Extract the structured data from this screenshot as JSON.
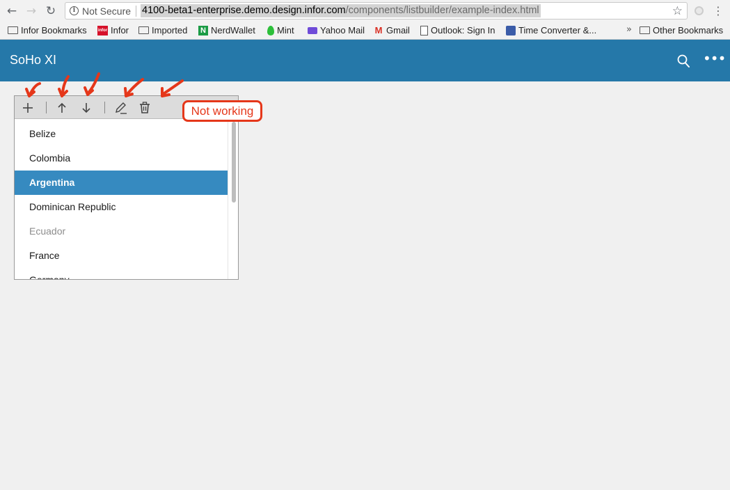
{
  "browser": {
    "back": "←",
    "forward": "→",
    "reload": "↻",
    "security_label": "Not Secure",
    "url_host": "4100-beta1-enterprise.demo.design.infor.com",
    "url_path": "/components/listbuilder/example-index.html",
    "bookmark_star": "☆",
    "menu": "⋮",
    "bookmarks": [
      {
        "label": "Infor Bookmarks",
        "icon": "folder-icon"
      },
      {
        "label": "Infor",
        "icon": "infor-logo-icon",
        "icon_text": "infor"
      },
      {
        "label": "Imported",
        "icon": "folder-icon"
      },
      {
        "label": "NerdWallet",
        "icon": "nerdwallet-icon",
        "icon_text": "N"
      },
      {
        "label": "Mint",
        "icon": "mint-icon"
      },
      {
        "label": "Yahoo Mail",
        "icon": "mail-icon"
      },
      {
        "label": "Gmail",
        "icon": "gmail-icon",
        "icon_text": "M"
      },
      {
        "label": "Outlook: Sign In",
        "icon": "document-icon"
      },
      {
        "label": "Time Converter &...",
        "icon": "clock-icon"
      }
    ],
    "bookmarks_more": "»",
    "other_bookmarks": "Other Bookmarks"
  },
  "app": {
    "title": "SoHo XI",
    "more_label": "•••"
  },
  "listbuilder": {
    "items": [
      {
        "label": "Belize",
        "state": "normal"
      },
      {
        "label": "Colombia",
        "state": "normal"
      },
      {
        "label": "Argentina",
        "state": "selected"
      },
      {
        "label": "Dominican Republic",
        "state": "normal"
      },
      {
        "label": "Ecuador",
        "state": "disabled"
      },
      {
        "label": "France",
        "state": "normal"
      },
      {
        "label": "Germany",
        "state": "normal"
      }
    ]
  },
  "annotation": {
    "callout_text": "Not working"
  },
  "colors": {
    "header": "#2578a9",
    "selected_row": "#368ac0",
    "annotation": "#e5371a"
  }
}
